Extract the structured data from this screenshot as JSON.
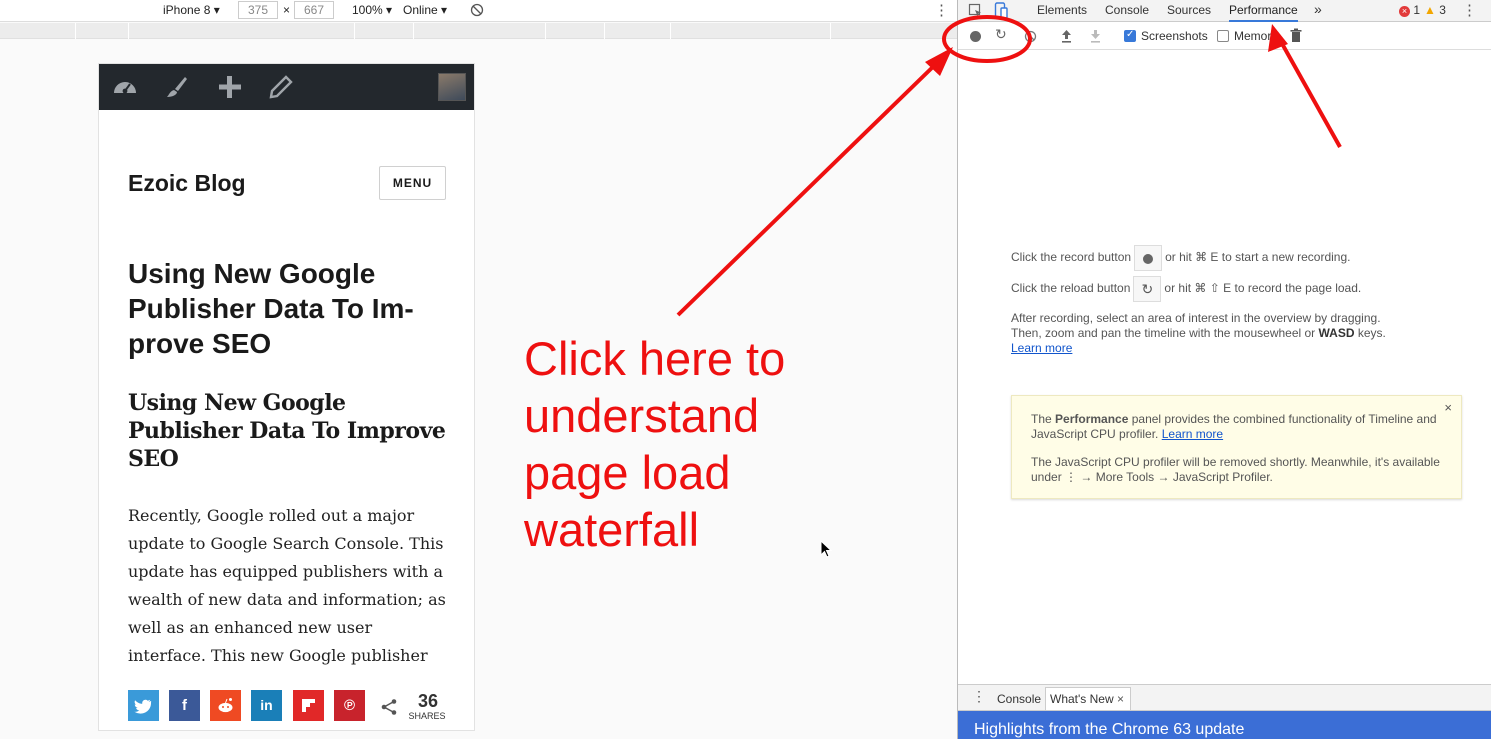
{
  "device_toolbar": {
    "device": "iPhone 8",
    "width": "375",
    "height": "667",
    "times": "×",
    "zoom": "100%",
    "network": "Online"
  },
  "phone": {
    "site_title": "Ezoic Blog",
    "menu_label": "MENU",
    "post_title": "Using New Google Publisher Data To Im-prove SEO",
    "post_subtitle": "Using New Google Publisher Data To Improve SEO",
    "post_body": "Recently, Google rolled out a major update to Google Search Console. This update has equipped publishers with a wealth of new data and information; as well as an enhanced new user interface. This new Google publisher data offers new opportunities for SEO and",
    "share_count": "36",
    "share_label": "SHARES",
    "share_colors": {
      "twitter": "#3a9ad9",
      "facebook": "#3b5998",
      "reddit": "#ef4a23",
      "linkedin": "#1a7fb8",
      "flipboard": "#e12828",
      "pinterest": "#c8232c"
    }
  },
  "annotation": {
    "line1": "Click here to",
    "line2": "understand",
    "line3": "page load",
    "line4": "waterfall",
    "color": "#ee1010"
  },
  "devtools": {
    "tabs": [
      "Elements",
      "Console",
      "Sources",
      "Performance"
    ],
    "more": "»",
    "errors": "1",
    "warnings": "3",
    "screenshots_label": "Screenshots",
    "memory_label": "Memory",
    "hint_record_a": "Click the record button",
    "hint_record_b": "or hit ⌘ E to start a new recording.",
    "hint_reload_a": "Click the reload button",
    "hint_reload_b": "or hit ⌘ ⇧ E to record the page load.",
    "hint_after_1": "After recording, select an area of interest in the overview by dragging.",
    "hint_after_2a": "Then, zoom and pan the timeline with the mousewheel or ",
    "hint_after_2b": "WASD",
    "hint_after_2c": " keys.",
    "learn_more": "Learn more",
    "info_1a": "The ",
    "info_1b": "Performance",
    "info_1c": " panel provides the combined functionality of Timeline and JavaScript CPU profiler. ",
    "info_2": "The JavaScript CPU profiler will be removed shortly. Meanwhile, it's available under ⋮ → More Tools → JavaScript Profiler.",
    "drawer_tab_console": "Console",
    "drawer_tab_whatsnew": "What's New",
    "drawer_banner": "Highlights from the Chrome 63 update"
  }
}
